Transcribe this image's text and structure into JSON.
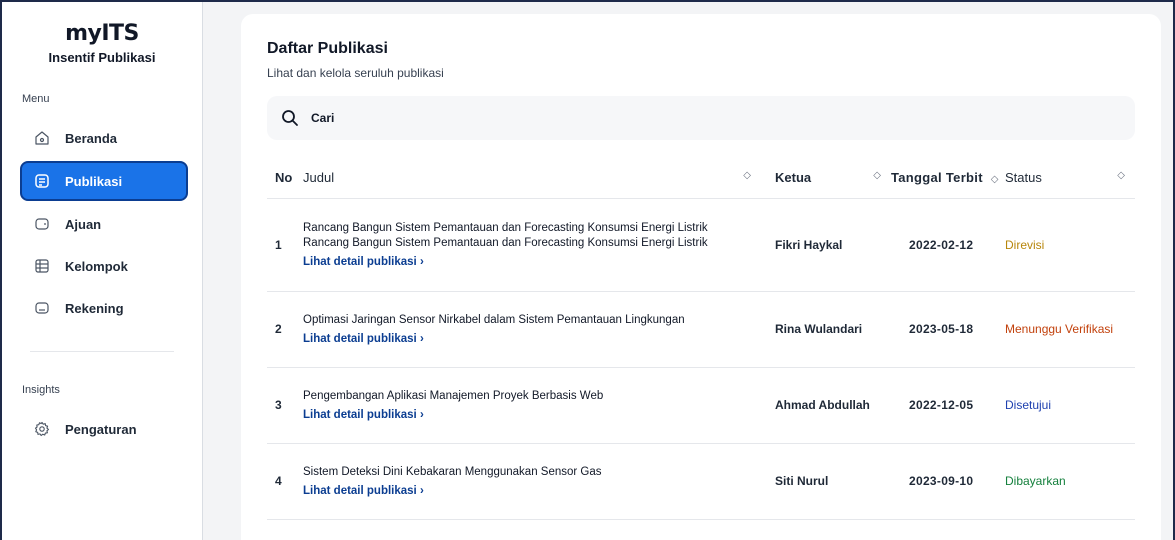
{
  "app": {
    "logo": "myITS",
    "subtitle": "Insentif Publikasi"
  },
  "sidebar": {
    "menu_label": "Menu",
    "items": [
      {
        "label": "Beranda",
        "icon": "home-icon"
      },
      {
        "label": "Publikasi",
        "icon": "document-icon",
        "active": true
      },
      {
        "label": "Ajuan",
        "icon": "card-icon"
      },
      {
        "label": "Kelompok",
        "icon": "grid-icon"
      },
      {
        "label": "Rekening",
        "icon": "wallet-icon"
      }
    ],
    "insights_label": "Insights",
    "insights_items": [
      {
        "label": "Pengaturan",
        "icon": "gear-icon"
      }
    ]
  },
  "page": {
    "title": "Daftar Publikasi",
    "subtitle": "Lihat dan kelola seruluh publikasi",
    "search_placeholder": "Cari"
  },
  "table": {
    "headers": {
      "no": "No",
      "judul": "Judul",
      "ketua": "Ketua",
      "tanggal": "Tanggal Terbit",
      "status": "Status"
    },
    "detail_link_label": "Lihat detail publikasi",
    "rows": [
      {
        "no": "1",
        "judul": "Rancang Bangun Sistem Pemantauan dan Forecasting Konsumsi Energi Listrik Rancang Bangun Sistem Pemantauan dan Forecasting Konsumsi Energi Listrik",
        "ketua": "Fikri Haykal",
        "tanggal": "2022-02-12",
        "status": "Direvisi",
        "status_color": "#b7860b"
      },
      {
        "no": "2",
        "judul": "Optimasi Jaringan Sensor Nirkabel dalam Sistem Pemantauan Lingkungan",
        "ketua": "Rina Wulandari",
        "tanggal": "2023-05-18",
        "status": "Menunggu Verifikasi",
        "status_color": "#c2410c"
      },
      {
        "no": "3",
        "judul": "Pengembangan Aplikasi Manajemen Proyek Berbasis Web",
        "ketua": "Ahmad Abdullah",
        "tanggal": "2022-12-05",
        "status": "Disetujui",
        "status_color": "#1e40af"
      },
      {
        "no": "4",
        "judul": "Sistem Deteksi Dini Kebakaran Menggunakan Sensor Gas",
        "ketua": "Siti Nurul",
        "tanggal": "2023-09-10",
        "status": "Dibayarkan",
        "status_color": "#15803d"
      }
    ]
  },
  "colors": {
    "accent": "#1a73e8",
    "accent_border": "#0b3d91",
    "link": "#0b3d91"
  }
}
